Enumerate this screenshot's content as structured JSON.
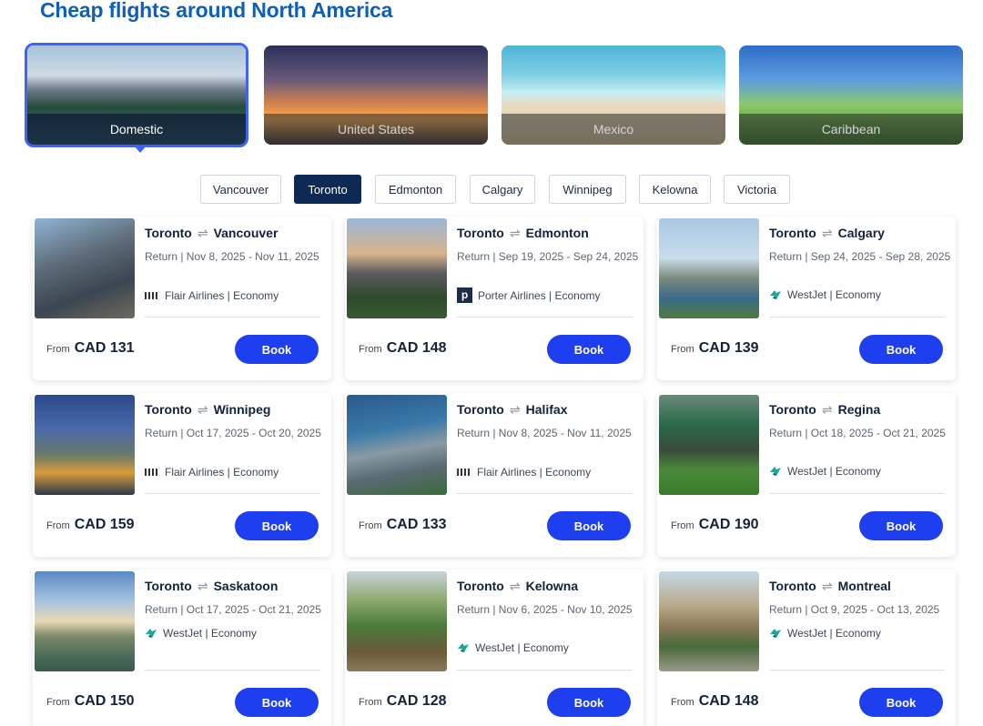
{
  "page_title": "Cheap flights around North America",
  "regions": [
    {
      "label": "Domestic",
      "active": true
    },
    {
      "label": "United States",
      "active": false
    },
    {
      "label": "Mexico",
      "active": false
    },
    {
      "label": "Caribbean",
      "active": false
    }
  ],
  "cities": [
    "Vancouver",
    "Toronto",
    "Edmonton",
    "Calgary",
    "Winnipeg",
    "Kelowna",
    "Victoria"
  ],
  "active_city": "Toronto",
  "colors": {
    "title": "#0f5fb8",
    "accent": "#1d3ff0",
    "active_city_bg": "#0d2a55"
  },
  "card_common": {
    "swap_symbol": "⇌",
    "from_label": "From",
    "book_label": "Book"
  },
  "cards": [
    {
      "origin": "Toronto",
      "destination": "Vancouver",
      "dates": "Return | Nov 8, 2025 - Nov 11, 2025",
      "airline": "Flair Airlines | Economy",
      "airline_logo": "flair-logo-icon",
      "price": "CAD 131"
    },
    {
      "origin": "Toronto",
      "destination": "Edmonton",
      "dates": "Return | Sep 19, 2025 - Sep 24, 2025",
      "airline": "Porter Airlines | Economy",
      "airline_logo": "porter-logo-icon",
      "price": "CAD 148"
    },
    {
      "origin": "Toronto",
      "destination": "Calgary",
      "dates": "Return | Sep 24, 2025 - Sep 28, 2025",
      "airline": "WestJet | Economy",
      "airline_logo": "westjet-logo-icon",
      "price": "CAD 139"
    },
    {
      "origin": "Toronto",
      "destination": "Winnipeg",
      "dates": "Return | Oct 17, 2025 - Oct 20, 2025",
      "airline": "Flair Airlines | Economy",
      "airline_logo": "flair-logo-icon",
      "price": "CAD 159"
    },
    {
      "origin": "Toronto",
      "destination": "Halifax",
      "dates": "Return | Nov 8, 2025 - Nov 11, 2025",
      "airline": "Flair Airlines | Economy",
      "airline_logo": "flair-logo-icon",
      "price": "CAD 133"
    },
    {
      "origin": "Toronto",
      "destination": "Regina",
      "dates": "Return | Oct 18, 2025 - Oct 21, 2025",
      "airline": "WestJet | Economy",
      "airline_logo": "westjet-logo-icon",
      "price": "CAD 190"
    },
    {
      "origin": "Toronto",
      "destination": "Saskatoon",
      "dates": "Return | Oct 17, 2025 - Oct 21, 2025",
      "airline": "WestJet | Economy",
      "airline_logo": "westjet-logo-icon",
      "price": "CAD 150"
    },
    {
      "origin": "Toronto",
      "destination": "Kelowna",
      "dates": "Return | Nov 6, 2025 - Nov 10, 2025",
      "airline": "WestJet | Economy",
      "airline_logo": "westjet-logo-icon",
      "price": "CAD 128"
    },
    {
      "origin": "Toronto",
      "destination": "Montreal",
      "dates": "Return | Oct 9, 2025 - Oct 13, 2025",
      "airline": "WestJet | Economy",
      "airline_logo": "westjet-logo-icon",
      "price": "CAD 148"
    }
  ]
}
